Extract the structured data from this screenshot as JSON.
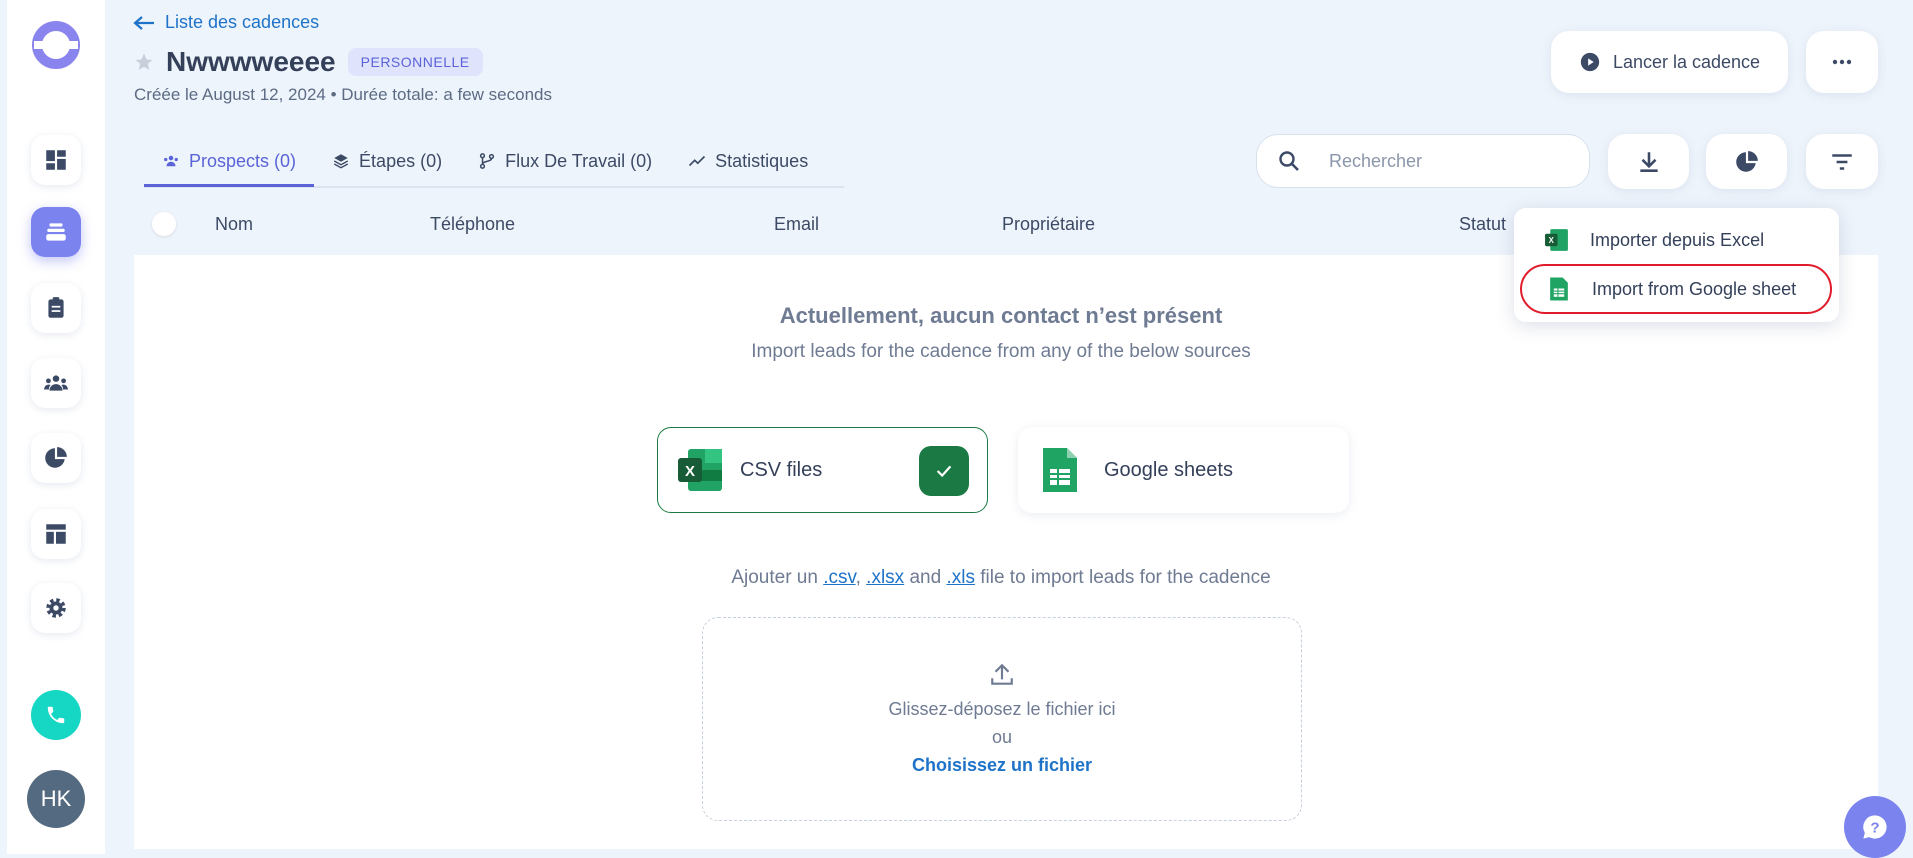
{
  "header": {
    "back_label": "Liste des cadences",
    "title": "Nwwwweeee",
    "badge": "PERSONNELLE",
    "meta": "Créée le August 12, 2024 • Durée totale: a few seconds",
    "launch_label": "Lancer la cadence"
  },
  "tabs": [
    {
      "label": "Prospects (0)",
      "icon": "people-icon"
    },
    {
      "label": "Étapes (0)",
      "icon": "layers-icon"
    },
    {
      "label": "Flux De Travail (0)",
      "icon": "branch-icon"
    },
    {
      "label": "Statistiques",
      "icon": "trend-icon"
    }
  ],
  "search": {
    "placeholder": "Rechercher"
  },
  "table": {
    "columns": [
      "Nom",
      "Téléphone",
      "Email",
      "Propriétaire",
      "Statut"
    ]
  },
  "empty": {
    "title": "Actuellement, aucun contact n’est présent",
    "subtitle": "Import leads for the cadence from any of the below sources"
  },
  "sources": {
    "csv_label": "CSV files",
    "gs_label": "Google sheets"
  },
  "hint": {
    "prefix": "Ajouter un",
    "csv": ".csv",
    "xlsx": ".xlsx",
    "and": "and",
    "xls": ".xls",
    "suffix": "file to import leads for the cadence"
  },
  "drop": {
    "line1": "Glissez-déposez le fichier ici",
    "line2": "ou",
    "choose": "Choisissez un fichier"
  },
  "dropdown": {
    "items": [
      {
        "label": "Importer depuis Excel",
        "icon": "excel-icon"
      },
      {
        "label": "Import from Google sheet",
        "icon": "google-sheets-icon"
      }
    ]
  },
  "user": {
    "initials": "HK"
  },
  "colors": {
    "accent": "#5a63d8",
    "excel_green": "#1b7a43",
    "highlight_red": "#e11b2b",
    "call_teal": "#16d6c4"
  }
}
